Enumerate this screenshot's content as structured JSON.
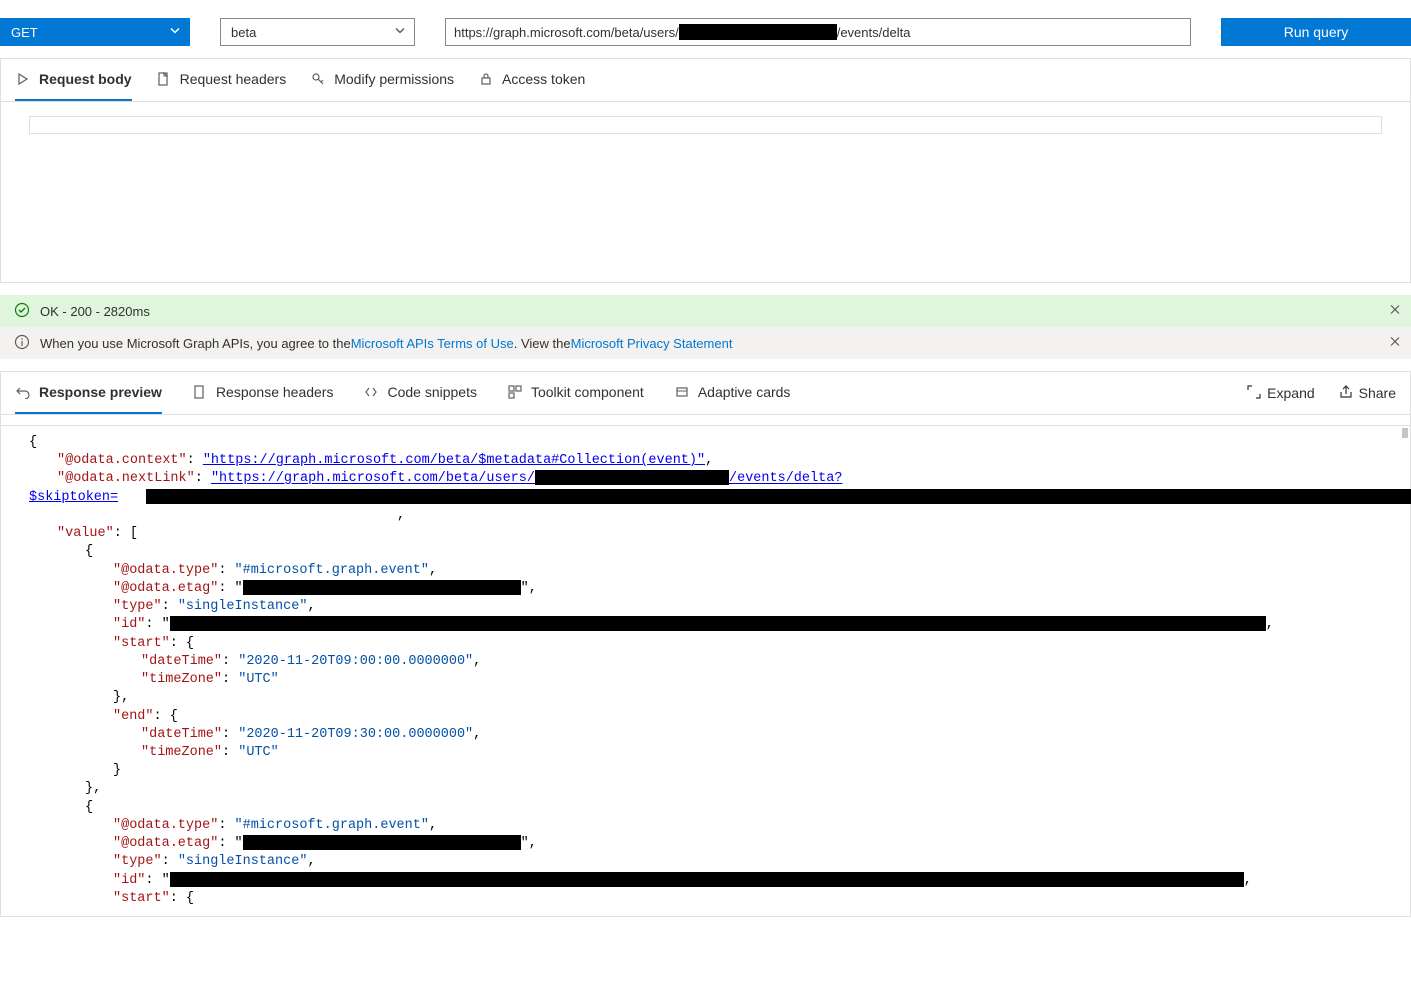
{
  "query": {
    "method": "GET",
    "version": "beta",
    "url_prefix": "https://graph.microsoft.com/beta/users/",
    "url_suffix": "/events/delta",
    "run_label": "Run query"
  },
  "reqtabs": {
    "body": "Request body",
    "headers": "Request headers",
    "permissions": "Modify permissions",
    "token": "Access token"
  },
  "status": {
    "text": "OK - 200 - 2820ms"
  },
  "info": {
    "pre": "When you use Microsoft Graph APIs, you agree to the ",
    "link1": "Microsoft APIs Terms of Use",
    "mid": ". View the ",
    "link2": "Microsoft Privacy Statement"
  },
  "resptabs": {
    "preview": "Response preview",
    "headers": "Response headers",
    "snippets": "Code snippets",
    "toolkit": "Toolkit component",
    "adaptive": "Adaptive cards"
  },
  "actions": {
    "expand": "Expand",
    "share": "Share"
  },
  "json": {
    "odata_context_key": "\"@odata.context\"",
    "odata_context_val": "\"https://graph.microsoft.com/beta/$metadata#Collection(event)\"",
    "odata_nextlink_key": "\"@odata.nextLink\"",
    "odata_nextlink_pre": "\"https://graph.microsoft.com/beta/users/",
    "odata_nextlink_post": "/events/delta?",
    "skiptoken_label": "$skiptoken=",
    "value_key": "\"value\"",
    "odata_type_key": "\"@odata.type\"",
    "odata_type_val": "\"#microsoft.graph.event\"",
    "odata_etag_key": "\"@odata.etag\"",
    "type_key": "\"type\"",
    "type_val": "\"singleInstance\"",
    "id_key": "\"id\"",
    "start_key": "\"start\"",
    "end_key": "\"end\"",
    "datetime_key": "\"dateTime\"",
    "timezone_key": "\"timeZone\"",
    "timezone_val": "\"UTC\"",
    "start_dt": "\"2020-11-20T09:00:00.0000000\"",
    "end_dt": "\"2020-11-20T09:30:00.0000000\""
  }
}
